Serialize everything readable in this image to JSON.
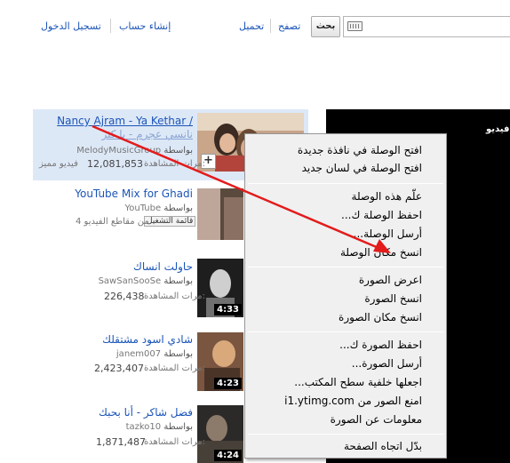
{
  "header": {
    "login": "تسجيل الدخول",
    "create_account": "إنشاء حساب",
    "upload": "تحميل",
    "browse": "تصفح",
    "search_button": "بحث"
  },
  "videos": [
    {
      "title": "Nancy Ajram - Ya Kethar /",
      "title_line2": "نانسي عجرم - يا كثر",
      "by_label": "بواسطة",
      "channel": "MelodyMusicGroup",
      "views_label": "مرات المشاهدة:",
      "views": "12,081,853",
      "badge": "فيديو مميز"
    },
    {
      "title": "YouTube Mix for Ghadi",
      "by_label": "بواسطة",
      "channel": "YouTube",
      "playlist_label": "قائمة التشغيل",
      "clips": "4 من مقاطع الفيديو"
    },
    {
      "title": "حاولت انساك",
      "by_label": "بواسطة",
      "channel": "SawSanSooSe",
      "views_label": "مرات المشاهدة:",
      "views": "226,438",
      "duration": "4:33"
    },
    {
      "title": "شادي اسود مشتقلك",
      "by_label": "بواسطة",
      "channel": "janem007",
      "views_label": "مرات المشاهدة:",
      "views": "2,423,407",
      "duration": "4:23"
    },
    {
      "title": "فضل شاكر - أنا بحبك",
      "by_label": "بواسطة",
      "channel": "tazko10",
      "views_label": "مرات المشاهدة:",
      "views": "1,871,487",
      "duration": "4:24"
    }
  ],
  "player": {
    "caption": "فيديو."
  },
  "context_menu": {
    "items": [
      "افتح الوصلة في نافذة جديدة",
      "افتح الوصلة في لسان جديد",
      "علّم هذه الوصلة",
      "احفظ الوصلة ك...",
      "أرسل الوصلة...",
      "انسخ مكان الوصلة",
      "اعرض الصورة",
      "انسخ الصورة",
      "انسخ مكان الصورة",
      "احفظ الصورة ك...",
      "أرسل الصورة...",
      "اجعلها خلفية سطح المكتب...",
      "امنع الصور من i1.ytimg.com",
      "معلومات عن الصورة",
      "بدّل اتجاه الصفحة"
    ]
  },
  "colors": {
    "link": "#1b55b8",
    "highlight": "#dde8f7",
    "arrow": "#e31b1b",
    "menu_bg": "#f0f0f0"
  }
}
